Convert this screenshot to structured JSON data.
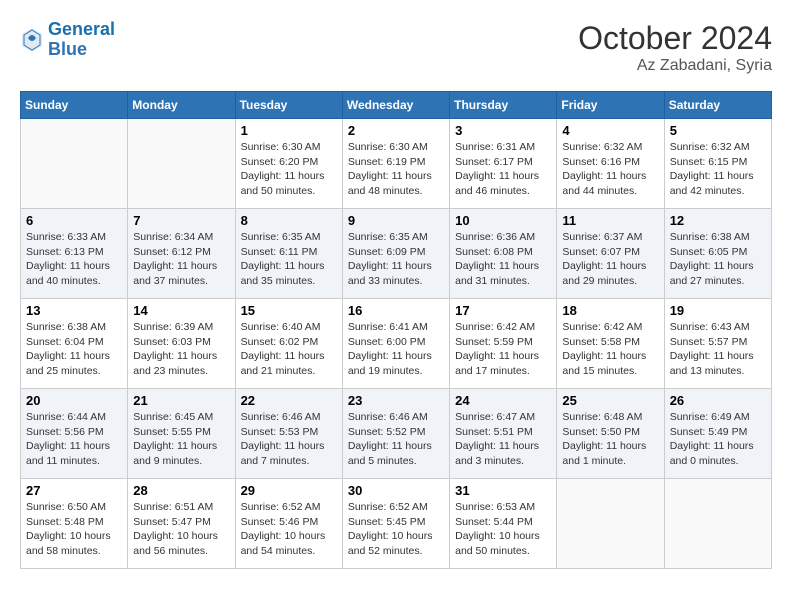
{
  "header": {
    "logo_line1": "General",
    "logo_line2": "Blue",
    "month_year": "October 2024",
    "location": "Az Zabadani, Syria"
  },
  "weekdays": [
    "Sunday",
    "Monday",
    "Tuesday",
    "Wednesday",
    "Thursday",
    "Friday",
    "Saturday"
  ],
  "weeks": [
    [
      {
        "day": "",
        "content": ""
      },
      {
        "day": "",
        "content": ""
      },
      {
        "day": "1",
        "content": "Sunrise: 6:30 AM\nSunset: 6:20 PM\nDaylight: 11 hours and 50 minutes."
      },
      {
        "day": "2",
        "content": "Sunrise: 6:30 AM\nSunset: 6:19 PM\nDaylight: 11 hours and 48 minutes."
      },
      {
        "day": "3",
        "content": "Sunrise: 6:31 AM\nSunset: 6:17 PM\nDaylight: 11 hours and 46 minutes."
      },
      {
        "day": "4",
        "content": "Sunrise: 6:32 AM\nSunset: 6:16 PM\nDaylight: 11 hours and 44 minutes."
      },
      {
        "day": "5",
        "content": "Sunrise: 6:32 AM\nSunset: 6:15 PM\nDaylight: 11 hours and 42 minutes."
      }
    ],
    [
      {
        "day": "6",
        "content": "Sunrise: 6:33 AM\nSunset: 6:13 PM\nDaylight: 11 hours and 40 minutes."
      },
      {
        "day": "7",
        "content": "Sunrise: 6:34 AM\nSunset: 6:12 PM\nDaylight: 11 hours and 37 minutes."
      },
      {
        "day": "8",
        "content": "Sunrise: 6:35 AM\nSunset: 6:11 PM\nDaylight: 11 hours and 35 minutes."
      },
      {
        "day": "9",
        "content": "Sunrise: 6:35 AM\nSunset: 6:09 PM\nDaylight: 11 hours and 33 minutes."
      },
      {
        "day": "10",
        "content": "Sunrise: 6:36 AM\nSunset: 6:08 PM\nDaylight: 11 hours and 31 minutes."
      },
      {
        "day": "11",
        "content": "Sunrise: 6:37 AM\nSunset: 6:07 PM\nDaylight: 11 hours and 29 minutes."
      },
      {
        "day": "12",
        "content": "Sunrise: 6:38 AM\nSunset: 6:05 PM\nDaylight: 11 hours and 27 minutes."
      }
    ],
    [
      {
        "day": "13",
        "content": "Sunrise: 6:38 AM\nSunset: 6:04 PM\nDaylight: 11 hours and 25 minutes."
      },
      {
        "day": "14",
        "content": "Sunrise: 6:39 AM\nSunset: 6:03 PM\nDaylight: 11 hours and 23 minutes."
      },
      {
        "day": "15",
        "content": "Sunrise: 6:40 AM\nSunset: 6:02 PM\nDaylight: 11 hours and 21 minutes."
      },
      {
        "day": "16",
        "content": "Sunrise: 6:41 AM\nSunset: 6:00 PM\nDaylight: 11 hours and 19 minutes."
      },
      {
        "day": "17",
        "content": "Sunrise: 6:42 AM\nSunset: 5:59 PM\nDaylight: 11 hours and 17 minutes."
      },
      {
        "day": "18",
        "content": "Sunrise: 6:42 AM\nSunset: 5:58 PM\nDaylight: 11 hours and 15 minutes."
      },
      {
        "day": "19",
        "content": "Sunrise: 6:43 AM\nSunset: 5:57 PM\nDaylight: 11 hours and 13 minutes."
      }
    ],
    [
      {
        "day": "20",
        "content": "Sunrise: 6:44 AM\nSunset: 5:56 PM\nDaylight: 11 hours and 11 minutes."
      },
      {
        "day": "21",
        "content": "Sunrise: 6:45 AM\nSunset: 5:55 PM\nDaylight: 11 hours and 9 minutes."
      },
      {
        "day": "22",
        "content": "Sunrise: 6:46 AM\nSunset: 5:53 PM\nDaylight: 11 hours and 7 minutes."
      },
      {
        "day": "23",
        "content": "Sunrise: 6:46 AM\nSunset: 5:52 PM\nDaylight: 11 hours and 5 minutes."
      },
      {
        "day": "24",
        "content": "Sunrise: 6:47 AM\nSunset: 5:51 PM\nDaylight: 11 hours and 3 minutes."
      },
      {
        "day": "25",
        "content": "Sunrise: 6:48 AM\nSunset: 5:50 PM\nDaylight: 11 hours and 1 minute."
      },
      {
        "day": "26",
        "content": "Sunrise: 6:49 AM\nSunset: 5:49 PM\nDaylight: 11 hours and 0 minutes."
      }
    ],
    [
      {
        "day": "27",
        "content": "Sunrise: 6:50 AM\nSunset: 5:48 PM\nDaylight: 10 hours and 58 minutes."
      },
      {
        "day": "28",
        "content": "Sunrise: 6:51 AM\nSunset: 5:47 PM\nDaylight: 10 hours and 56 minutes."
      },
      {
        "day": "29",
        "content": "Sunrise: 6:52 AM\nSunset: 5:46 PM\nDaylight: 10 hours and 54 minutes."
      },
      {
        "day": "30",
        "content": "Sunrise: 6:52 AM\nSunset: 5:45 PM\nDaylight: 10 hours and 52 minutes."
      },
      {
        "day": "31",
        "content": "Sunrise: 6:53 AM\nSunset: 5:44 PM\nDaylight: 10 hours and 50 minutes."
      },
      {
        "day": "",
        "content": ""
      },
      {
        "day": "",
        "content": ""
      }
    ]
  ]
}
